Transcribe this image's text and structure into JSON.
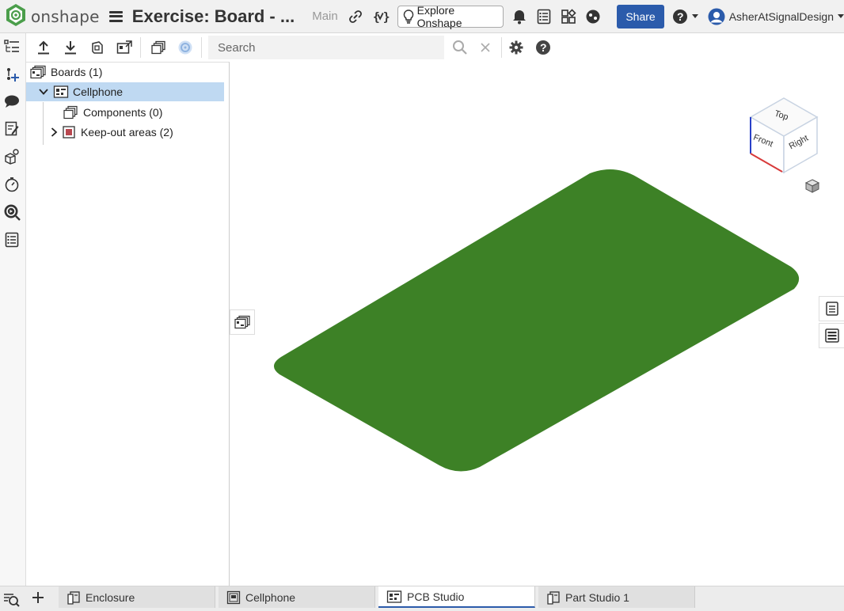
{
  "app": {
    "name": "onshape",
    "doc_title": "Exercise: Board - ...",
    "branch": "Main",
    "explore_label": "Explore Onshape",
    "share_label": "Share",
    "user_name": "AsherAtSignalDesign"
  },
  "toolbar": {
    "search_placeholder": "Search"
  },
  "tree": {
    "boards_label": "Boards (1)",
    "cellphone_label": "Cellphone",
    "components_label": "Components (0)",
    "keepout_label": "Keep-out areas (2)"
  },
  "viewcube": {
    "top": "Top",
    "front": "Front",
    "right": "Right"
  },
  "tabs": [
    {
      "label": "Enclosure"
    },
    {
      "label": "Cellphone"
    },
    {
      "label": "PCB Studio"
    },
    {
      "label": "Part Studio 1"
    }
  ],
  "colors": {
    "board": "#3d8126",
    "accent": "#2b5bab",
    "selection": "#bfd9f2"
  }
}
